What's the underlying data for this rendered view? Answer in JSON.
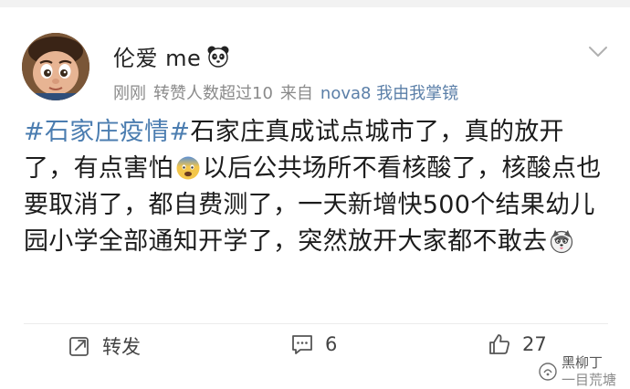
{
  "post": {
    "username": "伦爱 me",
    "meta": {
      "time": "刚刚",
      "reposts": "转赞人数超过10",
      "source_prefix": "来自",
      "device": "nova8 我由我掌镜"
    },
    "content": {
      "hashtag": "#石家庄疫情#",
      "text1": "石家庄真成试点城市了，真的放开了，有点害怕",
      "text2": "以后公共场所不看核酸了，核酸点也要取消了，都自费测了，一天新增快500个结果幼儿园小学全部通知开学了，突然放开大家都不敢去"
    },
    "actions": {
      "repost_label": "转发",
      "comment_count": "6",
      "like_count": "27"
    }
  },
  "watermark": {
    "line1": "黑柳丁",
    "line2": "一目荒塘"
  },
  "icons": {
    "avatar": "cartoon-boy-avatar",
    "badge": "panda-icon",
    "menu": "chevron-down-icon",
    "emoji1": "fearful-face-emoji",
    "emoji2": "husky-dog-emoji",
    "repost": "repost-icon",
    "comment": "comment-icon",
    "like": "thumbs-up-icon"
  },
  "colors": {
    "hashtag": "#4b7db0",
    "meta": "#8a8a8a",
    "text": "#1c1c1c"
  }
}
